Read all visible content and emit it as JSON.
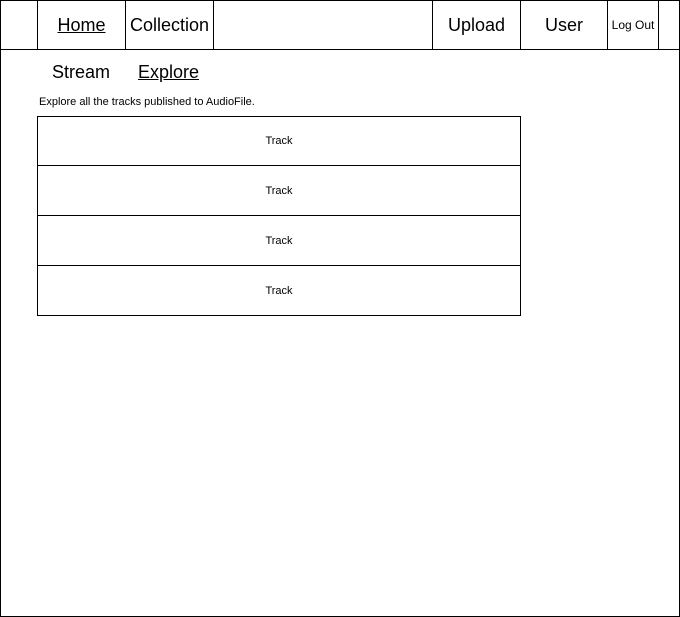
{
  "header": {
    "home_label": "Home",
    "collection_label": "Collection",
    "upload_label": "Upload",
    "user_label": "User",
    "logout_label": "Log Out"
  },
  "subnav": {
    "stream_label": "Stream",
    "explore_label": "Explore"
  },
  "main": {
    "description": "Explore all the tracks published to AudioFile.",
    "tracks": [
      {
        "label": "Track"
      },
      {
        "label": "Track"
      },
      {
        "label": "Track"
      },
      {
        "label": "Track"
      }
    ]
  }
}
